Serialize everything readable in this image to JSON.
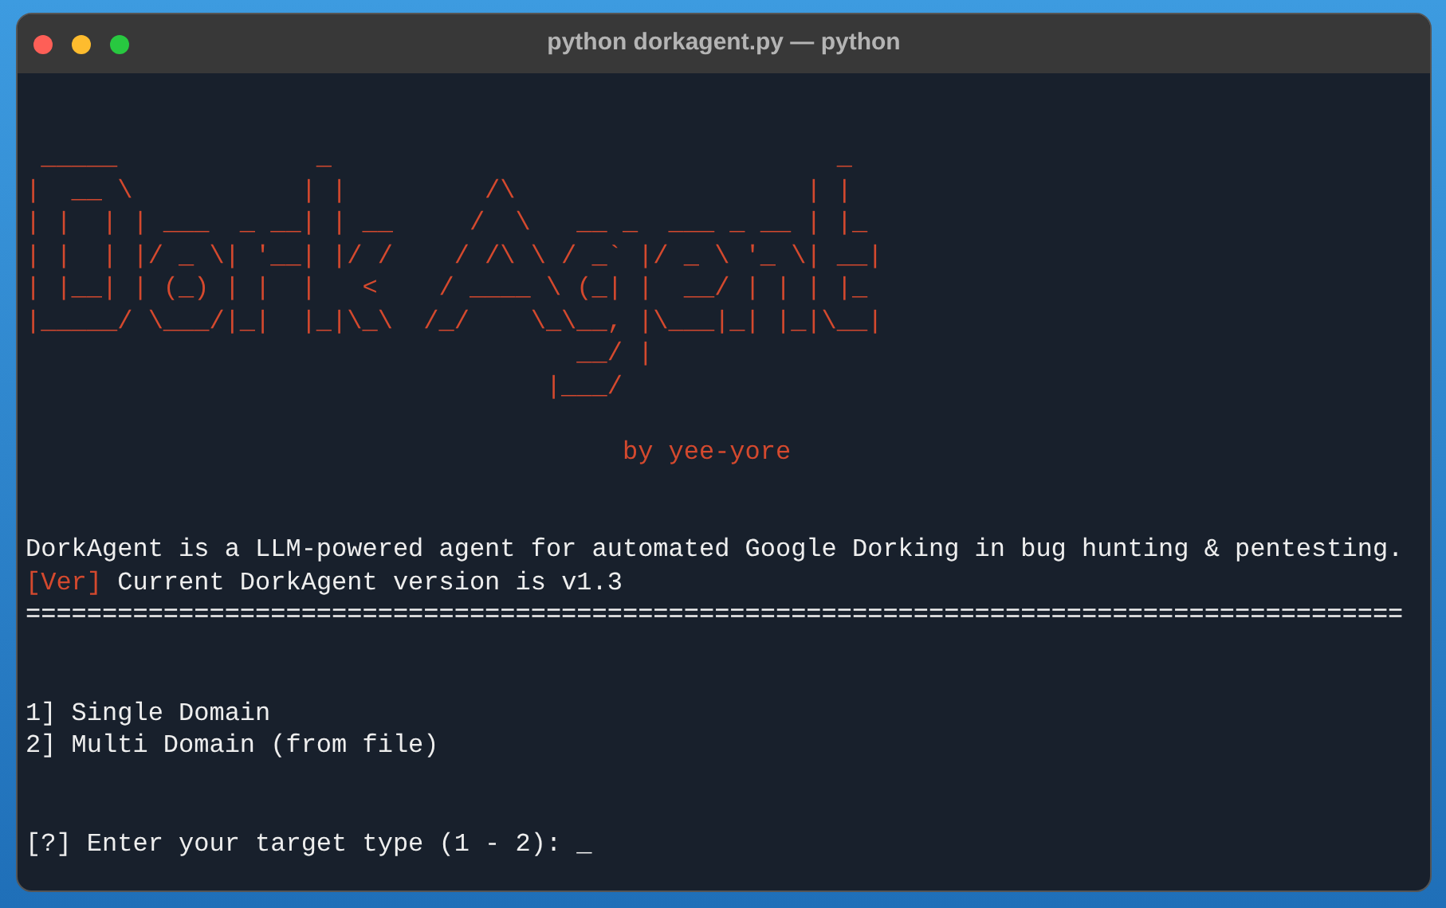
{
  "window": {
    "title": "python dorkagent.py — python"
  },
  "terminal": {
    "banner": [
      " _____             _                                 _   ",
      "|  __ \\           | |         /\\                   | |  ",
      "| |  | | ___  _ __| | __     /  \\   __ _  ___ _ __ | |_ ",
      "| |  | |/ _ \\| '__| |/ /    / /\\ \\ / _` |/ _ \\ '_ \\| __|",
      "| |__| | (_) | |  |   <    / ____ \\ (_| |  __/ | | | |_ ",
      "|_____/ \\___/|_|  |_|\\_\\  /_/    \\_\\__, |\\___|_| |_|\\__|",
      "                                    __/ |",
      "                                  |___/"
    ],
    "credit": "                                       by yee-yore",
    "description": "DorkAgent is a LLM-powered agent for automated Google Dorking in bug hunting & pentesting.",
    "version": {
      "tag": "[Ver]",
      "text": " Current DorkAgent version is v1.3"
    },
    "rule": "==========================================================================================",
    "menu": [
      "1] Single Domain",
      "2] Multi Domain (from file)"
    ],
    "prompt": "[?] Enter your target type (1 - 2): ",
    "cursor": "_"
  }
}
